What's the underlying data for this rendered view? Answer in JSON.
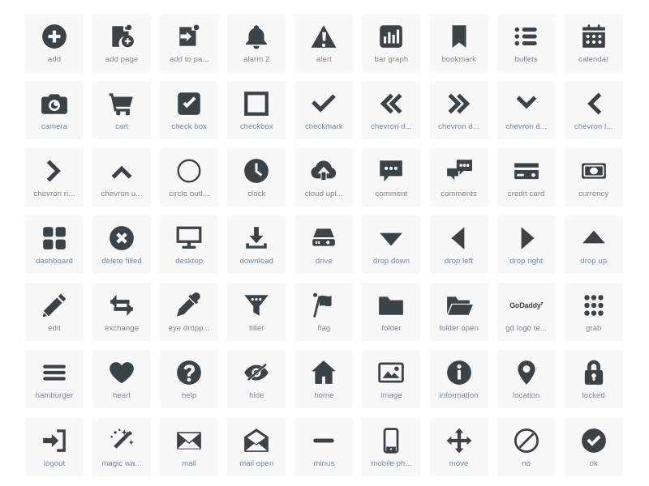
{
  "page": {
    "title": "Icon Library Gallery",
    "background_color": "#ffffff",
    "card_color": "#f7f8f8",
    "icon_color": "#3c4347",
    "label_color": "#7b8793",
    "columns": 9,
    "rows": 7,
    "total_icons": 63
  },
  "icons": [
    {
      "name": "add-icon",
      "label": "add",
      "full_label": "add"
    },
    {
      "name": "add-page-icon",
      "label": "add page",
      "full_label": "add page"
    },
    {
      "name": "add-to-page-icon",
      "label": "add to pa...",
      "full_label": "add to page"
    },
    {
      "name": "alarm-2-icon",
      "label": "alarm 2",
      "full_label": "alarm 2"
    },
    {
      "name": "alert-icon",
      "label": "alert",
      "full_label": "alert"
    },
    {
      "name": "bar-graph-icon",
      "label": "bar graph",
      "full_label": "bar graph"
    },
    {
      "name": "bookmark-icon",
      "label": "bookmark",
      "full_label": "bookmark"
    },
    {
      "name": "bullets-icon",
      "label": "bullets",
      "full_label": "bullets"
    },
    {
      "name": "calendar-icon",
      "label": "calendar",
      "full_label": "calendar"
    },
    {
      "name": "camera-icon",
      "label": "camera",
      "full_label": "camera"
    },
    {
      "name": "cart-icon",
      "label": "cart",
      "full_label": "cart"
    },
    {
      "name": "check-box-icon",
      "label": "check box",
      "full_label": "check box"
    },
    {
      "name": "checkbox-icon",
      "label": "checkbox",
      "full_label": "checkbox"
    },
    {
      "name": "checkmark-icon",
      "label": "checkmark",
      "full_label": "checkmark"
    },
    {
      "name": "chevron-double-left-icon",
      "label": "chevron d...",
      "full_label": "chevron double left"
    },
    {
      "name": "chevron-double-right-icon",
      "label": "chevron d...",
      "full_label": "chevron double right"
    },
    {
      "name": "chevron-down-icon",
      "label": "chevron d...",
      "full_label": "chevron down"
    },
    {
      "name": "chevron-left-icon",
      "label": "chevron l...",
      "full_label": "chevron left"
    },
    {
      "name": "chevron-right-icon",
      "label": "chevron ri...",
      "full_label": "chevron right"
    },
    {
      "name": "chevron-up-icon",
      "label": "chevron u...",
      "full_label": "chevron up"
    },
    {
      "name": "circle-outline-icon",
      "label": "circle outl...",
      "full_label": "circle outline"
    },
    {
      "name": "clock-icon",
      "label": "clock",
      "full_label": "clock"
    },
    {
      "name": "cloud-upload-icon",
      "label": "cloud upl...",
      "full_label": "cloud upload"
    },
    {
      "name": "comment-icon",
      "label": "comment",
      "full_label": "comment"
    },
    {
      "name": "comments-icon",
      "label": "comments",
      "full_label": "comments"
    },
    {
      "name": "credit-card-icon",
      "label": "credit card",
      "full_label": "credit card"
    },
    {
      "name": "currency-icon",
      "label": "currency",
      "full_label": "currency"
    },
    {
      "name": "dashboard-icon",
      "label": "dashboard",
      "full_label": "dashboard"
    },
    {
      "name": "delete-filled-icon",
      "label": "delete filled",
      "full_label": "delete filled"
    },
    {
      "name": "desktop-icon",
      "label": "desktop",
      "full_label": "desktop"
    },
    {
      "name": "download-icon",
      "label": "download",
      "full_label": "download"
    },
    {
      "name": "drive-icon",
      "label": "drive",
      "full_label": "drive"
    },
    {
      "name": "drop-down-icon",
      "label": "drop down",
      "full_label": "drop down"
    },
    {
      "name": "drop-left-icon",
      "label": "drop left",
      "full_label": "drop left"
    },
    {
      "name": "drop-right-icon",
      "label": "drop right",
      "full_label": "drop right"
    },
    {
      "name": "drop-up-icon",
      "label": "drop up",
      "full_label": "drop up"
    },
    {
      "name": "edit-icon",
      "label": "edit",
      "full_label": "edit"
    },
    {
      "name": "exchange-icon",
      "label": "exchange",
      "full_label": "exchange"
    },
    {
      "name": "eye-dropper-icon",
      "label": "eye dropp...",
      "full_label": "eye dropper"
    },
    {
      "name": "filter-icon",
      "label": "filter",
      "full_label": "filter"
    },
    {
      "name": "flag-icon",
      "label": "flag",
      "full_label": "flag"
    },
    {
      "name": "folder-icon",
      "label": "folder",
      "full_label": "folder"
    },
    {
      "name": "folder-open-icon",
      "label": "folder open",
      "full_label": "folder open"
    },
    {
      "name": "gd-logo-text-icon",
      "label": "gd logo te...",
      "full_label": "gd logo text",
      "wordmark": "GoDaddy"
    },
    {
      "name": "grab-icon",
      "label": "grab",
      "full_label": "grab"
    },
    {
      "name": "hamburger-icon",
      "label": "hamburger",
      "full_label": "hamburger"
    },
    {
      "name": "heart-icon",
      "label": "heart",
      "full_label": "heart"
    },
    {
      "name": "help-icon",
      "label": "help",
      "full_label": "help"
    },
    {
      "name": "hide-icon",
      "label": "hide",
      "full_label": "hide"
    },
    {
      "name": "home-icon",
      "label": "home",
      "full_label": "home"
    },
    {
      "name": "image-icon",
      "label": "image",
      "full_label": "image"
    },
    {
      "name": "information-icon",
      "label": "information",
      "full_label": "information"
    },
    {
      "name": "location-icon",
      "label": "location",
      "full_label": "location"
    },
    {
      "name": "locked-icon",
      "label": "locked",
      "full_label": "locked"
    },
    {
      "name": "logout-icon",
      "label": "logout",
      "full_label": "logout"
    },
    {
      "name": "magic-wand-icon",
      "label": "magic wa...",
      "full_label": "magic wand"
    },
    {
      "name": "mail-icon",
      "label": "mail",
      "full_label": "mail"
    },
    {
      "name": "mail-open-icon",
      "label": "mail open",
      "full_label": "mail open"
    },
    {
      "name": "minus-icon",
      "label": "minus",
      "full_label": "minus"
    },
    {
      "name": "mobile-phone-icon",
      "label": "mobile ph...",
      "full_label": "mobile phone"
    },
    {
      "name": "move-icon",
      "label": "move",
      "full_label": "move"
    },
    {
      "name": "no-icon",
      "label": "no",
      "full_label": "no"
    },
    {
      "name": "ok-icon",
      "label": "ok",
      "full_label": "ok"
    }
  ]
}
